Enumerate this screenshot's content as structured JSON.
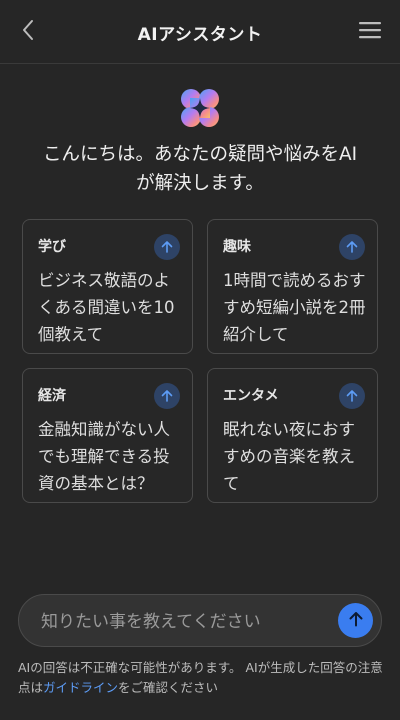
{
  "header": {
    "title": "AIアシスタント",
    "back_icon": "chevron-left-icon",
    "menu_icon": "hamburger-menu-icon"
  },
  "logo": {
    "icon": "ai-sparkle-logo-icon",
    "colors": [
      "#4aa3f5",
      "#b57cf0",
      "#f58b8b",
      "#f5c16b"
    ]
  },
  "greeting": {
    "line1": "こんにちは。あなたの疑問や悩みをAI",
    "line2": "が解決します。"
  },
  "suggestions": [
    {
      "label": "学び",
      "text": "ビジネス敬語のよくある間違いを10個教えて"
    },
    {
      "label": "趣味",
      "text": "1時間で読めるおすすめ短編小説を2冊紹介して"
    },
    {
      "label": "経済",
      "text": "金融知識がない人でも理解できる投資の基本とは？"
    },
    {
      "label": "エンタメ",
      "text": "眠れない夜におすすめの音楽を教えて"
    }
  ],
  "input": {
    "placeholder": "知りたい事を教えてください",
    "value": ""
  },
  "disclaimer": {
    "text_before": "AIの回答は不正確な可能性があります。 AIが生成した回答の注意点は",
    "link": "ガイドライン",
    "text_after": "をご確認ください"
  },
  "colors": {
    "background": "#262626",
    "accent": "#3a7df0",
    "link": "#5d9cf5"
  }
}
